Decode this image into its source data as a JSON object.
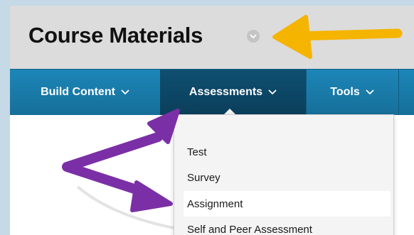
{
  "page": {
    "title": "Course Materials"
  },
  "action_bar": {
    "items": [
      {
        "label": "Build Content"
      },
      {
        "label": "Assessments"
      },
      {
        "label": "Tools"
      }
    ]
  },
  "dropdown": {
    "items": [
      {
        "label": "Test"
      },
      {
        "label": "Survey"
      },
      {
        "label": "Assignment"
      },
      {
        "label": "Self and Peer Assessment"
      }
    ]
  },
  "colors": {
    "action_bar": "#1c86b8",
    "action_bar_active": "#0f4f71",
    "header_bg": "#dcdcdc",
    "annotation_yellow": "#f5b400",
    "annotation_purple": "#7b2fa6"
  },
  "icons": {
    "title_menu": "chevron-down-circle-icon",
    "menu_chevron": "chevron-down-icon",
    "annotation_arrows": "arrow-icon"
  }
}
